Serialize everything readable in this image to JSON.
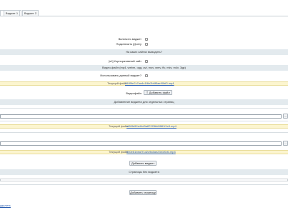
{
  "tabs": [
    {
      "label": ""
    },
    {
      "label": "Виджет 1"
    },
    {
      "label": "Виджет 2"
    }
  ],
  "settings": {
    "enable_widget": "Включить виджет ",
    "enable_jquery": "Подключить jQuery",
    "sites_header": "На каких сайтах выводить?",
    "site_label": "[s1] Корпоративный сайт",
    "file_header": "Видео-файл (mp4, webm, ogg, avi, mov, wmv, flv, mkv, m4v, 3gp)",
    "use_widget": "Использовать данный виджет?",
    "current_file_label": "Текущий файл: ",
    "current_file_value": "5189fe7c7aa4c1f6e2b6f5ae90bf3.mp4",
    "upload_label": "Видеофайл",
    "upload_button": "Добавить файл",
    "pages_header": "Добавление виджета для отдельных страниц"
  },
  "page1": {
    "input_value": "",
    "side_button": "...",
    "current_file_label": "Текущий файл: ",
    "current_file_value": "af69fd92e44d3a872256d9f6f1f1c5.mp4"
  },
  "page2": {
    "input_value": "",
    "side_button": "...",
    "current_file_label": "Текущий файл ",
    "current_file_value": "660e61bea7f1d2c9a5ae23b1f0d0.mp4"
  },
  "actions": {
    "add_widget": "Добавить виджет",
    "pages_without_header": "Страницы без виджета",
    "add_page": "Добавить страницу",
    "bottom_link": "удалить"
  }
}
